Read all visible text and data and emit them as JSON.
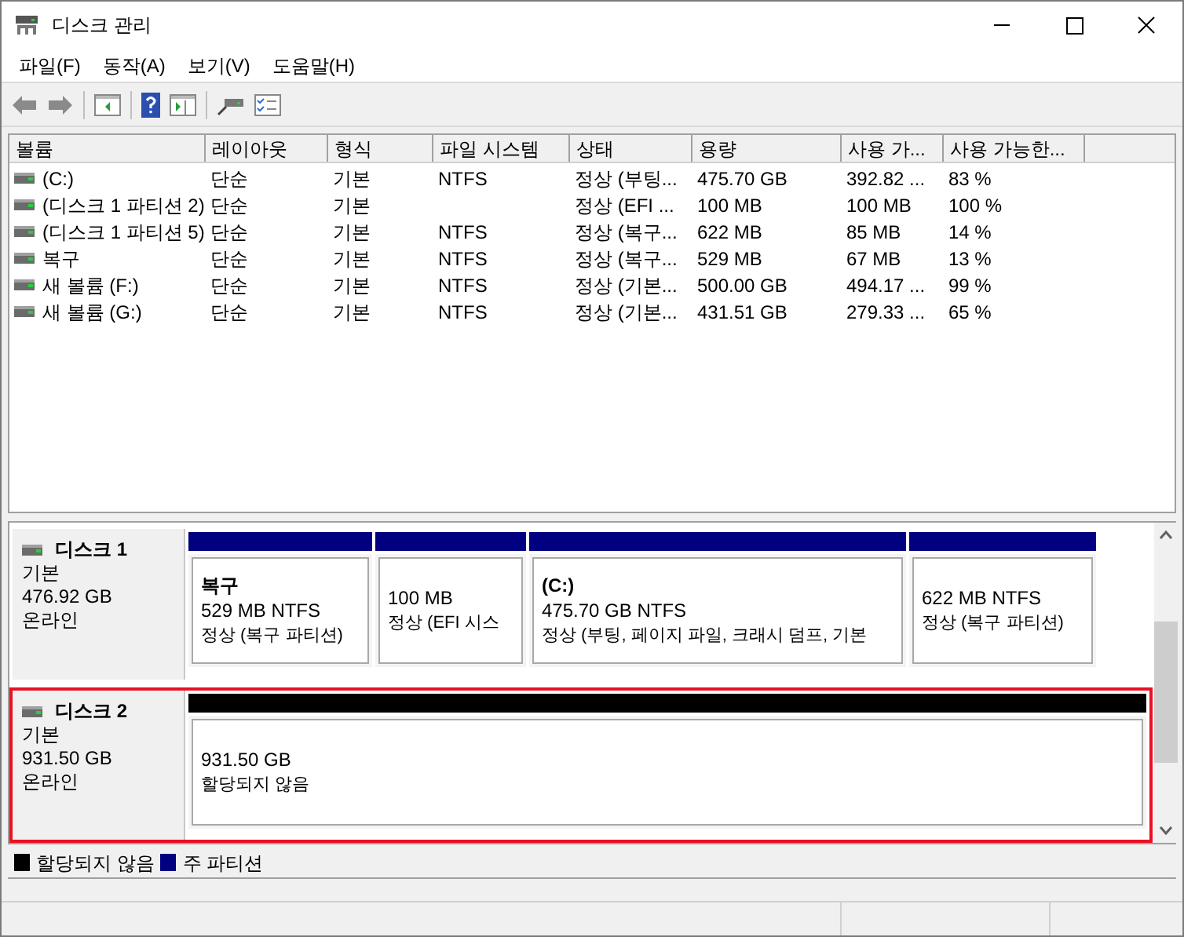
{
  "window": {
    "title": "디스크 관리"
  },
  "menu": [
    "파일(F)",
    "동작(A)",
    "보기(V)",
    "도움말(H)"
  ],
  "table": {
    "columns": [
      "볼륨",
      "레이아웃",
      "형식",
      "파일 시스템",
      "상태",
      "용량",
      "사용 가...",
      "사용 가능한..."
    ],
    "rows": [
      [
        "(C:)",
        "단순",
        "기본",
        "NTFS",
        "정상 (부팅...",
        "475.70 GB",
        "392.82 ...",
        "83 %"
      ],
      [
        "(디스크 1 파티션 2)",
        "단순",
        "기본",
        "",
        "정상 (EFI ...",
        "100 MB",
        "100 MB",
        "100 %"
      ],
      [
        "(디스크 1 파티션 5)",
        "단순",
        "기본",
        "NTFS",
        "정상 (복구...",
        "622 MB",
        "85 MB",
        "14 %"
      ],
      [
        "복구",
        "단순",
        "기본",
        "NTFS",
        "정상 (복구...",
        "529 MB",
        "67 MB",
        "13 %"
      ],
      [
        "새 볼륨 (F:)",
        "단순",
        "기본",
        "NTFS",
        "정상 (기본...",
        "500.00 GB",
        "494.17 ...",
        "99 %"
      ],
      [
        "새 볼륨 (G:)",
        "단순",
        "기본",
        "NTFS",
        "정상 (기본...",
        "431.51 GB",
        "279.33 ...",
        "65 %"
      ]
    ]
  },
  "disks": [
    {
      "name": "디스크 1",
      "type": "기본",
      "size": "476.92 GB",
      "status": "온라인",
      "highlighted": false,
      "partitions": [
        {
          "title": "복구",
          "size": "529 MB NTFS",
          "status": "정상 (복구 파티션)",
          "color": "#000080"
        },
        {
          "size": "100 MB",
          "status": "정상 (EFI 시스",
          "color": "#000080"
        },
        {
          "title": "(C:)",
          "size": "475.70 GB NTFS",
          "status": "정상 (부팅, 페이지 파일, 크래시 덤프, 기본",
          "color": "#000080"
        },
        {
          "size": "622 MB NTFS",
          "status": "정상 (복구 파티션)",
          "color": "#000080"
        }
      ]
    },
    {
      "name": "디스크 2",
      "type": "기본",
      "size": "931.50 GB",
      "status": "온라인",
      "highlighted": true,
      "partitions": [
        {
          "size": "931.50 GB",
          "status": "할당되지 않음",
          "color": "#000000"
        }
      ]
    }
  ],
  "legend": [
    {
      "label": "할당되지 않음",
      "color": "#000000"
    },
    {
      "label": "주 파티션",
      "color": "#000080"
    }
  ]
}
